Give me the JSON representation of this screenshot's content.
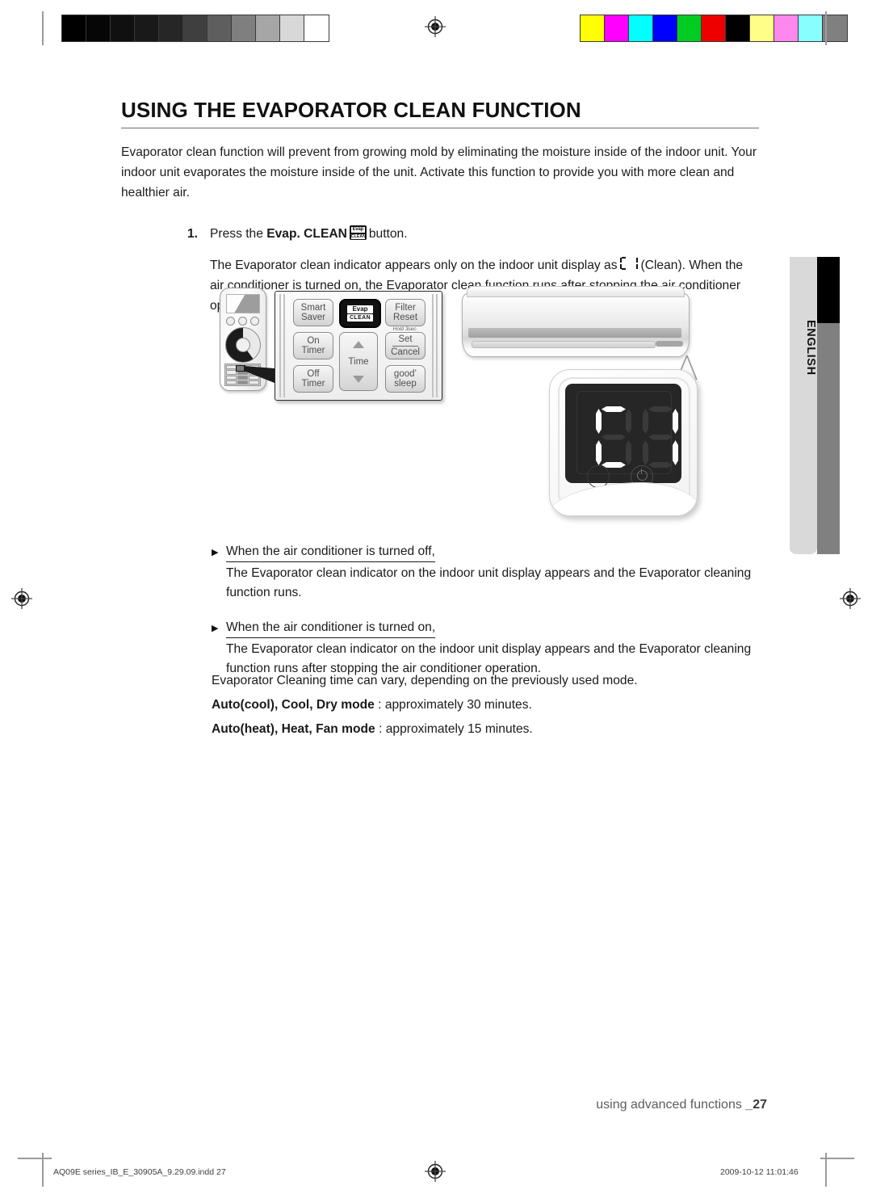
{
  "document": {
    "title": "USING THE EVAPORATOR CLEAN FUNCTION",
    "intro": "Evaporator clean function will prevent from growing mold by eliminating the moisture inside of the indoor unit. Your indoor unit evaporates the moisture inside of the unit. Activate this function to provide you with more clean and healthier air."
  },
  "step": {
    "number": "1.",
    "prefix": "Press the",
    "bold_label": "Evap. CLEAN",
    "suffix": "button.",
    "body_line1_before": "The Evaporator clean indicator appears only on the indoor unit display as",
    "body_line1_after": "(Clean).",
    "body_line2": "When the air conditioner is turned on, the Evaporator clean function runs after stopping the air conditioner operation."
  },
  "remote": {
    "buttons": [
      {
        "id": "smart-saver",
        "line1": "Smart",
        "line2": "Saver"
      },
      {
        "id": "evap-clean",
        "line1": "Evap",
        "line2": "CLEAN"
      },
      {
        "id": "filter-reset",
        "line1": "Filter",
        "line2": "Reset"
      },
      {
        "id": "on-timer",
        "line1": "On",
        "line2": "Timer"
      },
      {
        "id": "set-cancel",
        "line1": "Set",
        "line2": "Cancel"
      },
      {
        "id": "off-timer",
        "line1": "Off",
        "line2": "Timer"
      },
      {
        "id": "good-sleep",
        "line1": "good’",
        "line2": "sleep"
      }
    ],
    "time_label": "Time",
    "hold_note": "Hold 3sec."
  },
  "display": {
    "digit1": "C",
    "digit2": "I",
    "segments_digit1": [
      "a",
      "f",
      "e",
      "d"
    ],
    "segments_digit2": [
      "b",
      "c"
    ]
  },
  "bullets": [
    {
      "heading": "When the air conditioner is turned off,",
      "body": "The Evaporator clean indicator on the indoor unit display appears and the Evaporator cleaning function runs."
    },
    {
      "heading": "When the air conditioner is turned on,",
      "body": "The Evaporator clean indicator on the indoor unit display appears and the Evaporator cleaning function runs after stopping the air conditioner operation."
    }
  ],
  "timing": {
    "note": "Evaporator Cleaning time can vary, depending on the previously used mode.",
    "rows": [
      {
        "mode": "Auto(cool), Cool, Dry mode",
        "value": " : approximately 30 minutes."
      },
      {
        "mode": "Auto(heat), Heat, Fan mode",
        "value": " : approximately 15 minutes."
      }
    ]
  },
  "sidebar": {
    "language": "ENGLISH"
  },
  "footer": {
    "section": "using advanced functions",
    "page_marker": "_",
    "page": "27"
  },
  "imprint": {
    "left": "AQ09E series_IB_E_30905A_9.29.09.indd   27",
    "right": "2009-10-12   11:01:46"
  },
  "prepress": {
    "gray_swatches": [
      "#000000",
      "#060606",
      "#101010",
      "#191919",
      "#262626",
      "#3f3f3f",
      "#5e5e5e",
      "#7f7f7f",
      "#a6a6a6",
      "#d8d8d8",
      "#ffffff"
    ],
    "color_swatches": [
      "#ffff00",
      "#ff00ff",
      "#00ffff",
      "#0000ff",
      "#00cc22",
      "#ee0000",
      "#000000",
      "#ffff88",
      "#ff88ee",
      "#88ffff",
      "#808080"
    ]
  }
}
